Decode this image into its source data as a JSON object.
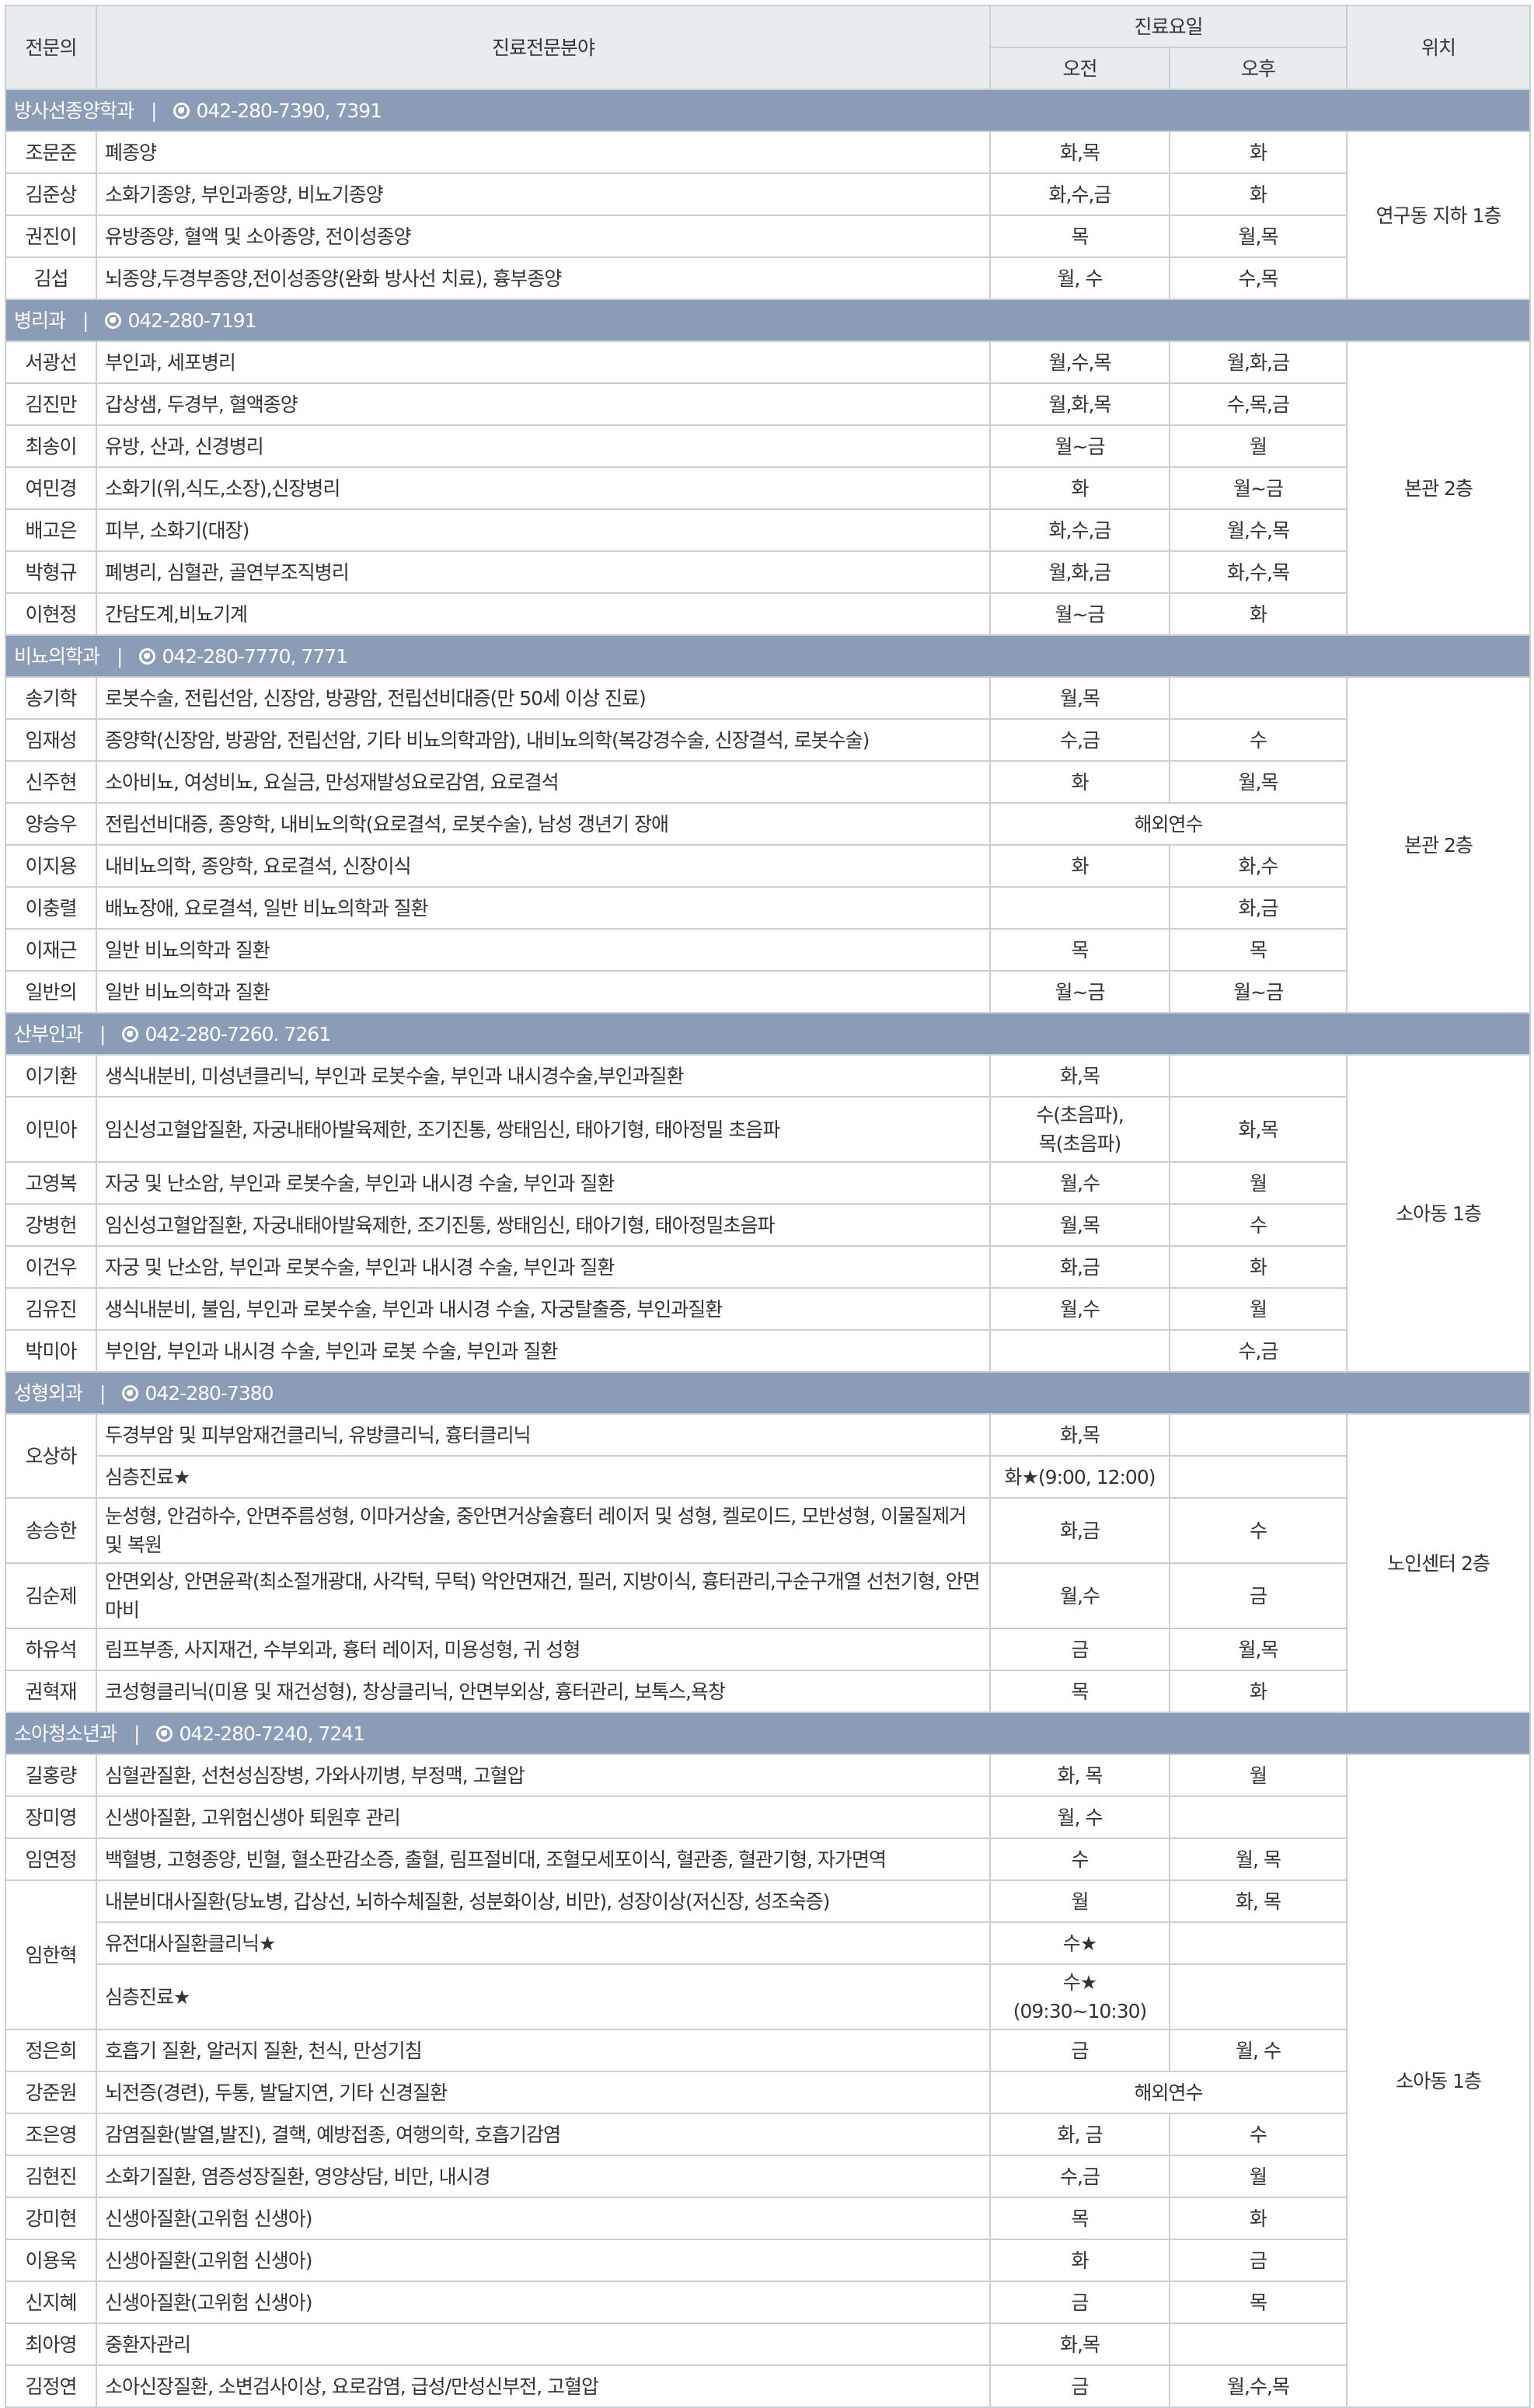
{
  "header": {
    "doctor": "전문의",
    "specialty": "진료전문분야",
    "schedule": "진료요일",
    "am": "오전",
    "pm": "오후",
    "location": "위치"
  },
  "departments": [
    {
      "name": "방사선종양학과",
      "phone": "042-280-7390, 7391",
      "location": "연구동 지하 1층",
      "doctors": [
        {
          "name": "조문준",
          "rows": [
            {
              "spec": "폐종양",
              "am": "화,목",
              "pm": "화"
            }
          ]
        },
        {
          "name": "김준상",
          "rows": [
            {
              "spec": "소화기종양, 부인과종양, 비뇨기종양",
              "am": "화,수,금",
              "pm": "화"
            }
          ]
        },
        {
          "name": "권진이",
          "rows": [
            {
              "spec": "유방종양, 혈액 및 소아종양, 전이성종양",
              "am": "목",
              "pm": "월,목"
            }
          ]
        },
        {
          "name": "김섭",
          "rows": [
            {
              "spec": "뇌종양,두경부종양,전이성종양(완화 방사선 치료), 흉부종양",
              "am": "월, 수",
              "pm": "수,목"
            }
          ]
        }
      ]
    },
    {
      "name": "병리과",
      "phone": "042-280-7191",
      "location": "본관 2층",
      "doctors": [
        {
          "name": "서광선",
          "rows": [
            {
              "spec": "부인과, 세포병리",
              "am": "월,수,목",
              "pm": "월,화,금"
            }
          ]
        },
        {
          "name": "김진만",
          "rows": [
            {
              "spec": "갑상샘, 두경부, 혈액종양",
              "am": "월,화,목",
              "pm": "수,목,금"
            }
          ]
        },
        {
          "name": "최송이",
          "rows": [
            {
              "spec": "유방, 산과, 신경병리",
              "am": "월~금",
              "pm": "월"
            }
          ]
        },
        {
          "name": "여민경",
          "rows": [
            {
              "spec": "소화기(위,식도,소장),신장병리",
              "am": "화",
              "pm": "월~금"
            }
          ]
        },
        {
          "name": "배고은",
          "rows": [
            {
              "spec": "피부, 소화기(대장)",
              "am": "화,수,금",
              "pm": "월,수,목"
            }
          ]
        },
        {
          "name": "박형규",
          "rows": [
            {
              "spec": "폐병리, 심혈관, 골연부조직병리",
              "am": "월,화,금",
              "pm": "화,수,목"
            }
          ]
        },
        {
          "name": "이현정",
          "rows": [
            {
              "spec": "간담도계,비뇨기계",
              "am": "월~금",
              "pm": "화"
            }
          ]
        }
      ]
    },
    {
      "name": "비뇨의학과",
      "phone": "042-280-7770, 7771",
      "location": "본관 2층",
      "doctors": [
        {
          "name": "송기학",
          "rows": [
            {
              "spec": "로봇수술, 전립선암, 신장암, 방광암, 전립선비대증(만 50세 이상 진료)",
              "am": "월,목",
              "pm": ""
            }
          ]
        },
        {
          "name": "임재성",
          "rows": [
            {
              "spec": "종양학(신장암, 방광암, 전립선암, 기타 비뇨의학과암), 내비뇨의학(복강경수술, 신장결석, 로봇수술)",
              "am": "수,금",
              "pm": "수"
            }
          ]
        },
        {
          "name": "신주현",
          "rows": [
            {
              "spec": "소아비뇨, 여성비뇨, 요실금, 만성재발성요로감염, 요로결석",
              "am": "화",
              "pm": "월,목"
            }
          ]
        },
        {
          "name": "양승우",
          "rows": [
            {
              "spec": "전립선비대증, 종양학, 내비뇨의학(요로결석, 로봇수술), 남성 갱년기 장애",
              "merged": "해외연수"
            }
          ]
        },
        {
          "name": "이지용",
          "rows": [
            {
              "spec": "내비뇨의학, 종양학, 요로결석, 신장이식",
              "am": "화",
              "pm": "화,수"
            }
          ]
        },
        {
          "name": "이충렬",
          "rows": [
            {
              "spec": "배뇨장애, 요로결석, 일반 비뇨의학과 질환",
              "am": "",
              "pm": "화,금"
            }
          ]
        },
        {
          "name": "이재근",
          "rows": [
            {
              "spec": "일반 비뇨의학과 질환",
              "am": "목",
              "pm": "목"
            }
          ]
        },
        {
          "name": "일반의",
          "rows": [
            {
              "spec": "일반 비뇨의학과 질환",
              "am": "월~금",
              "pm": "월~금"
            }
          ]
        }
      ]
    },
    {
      "name": "산부인과",
      "phone": "042-280-7260. 7261",
      "location": "소아동 1층",
      "doctors": [
        {
          "name": "이기환",
          "rows": [
            {
              "spec": "생식내분비, 미성년클리닉, 부인과 로봇수술, 부인과 내시경수술,부인과질환",
              "am": "화,목",
              "pm": ""
            }
          ]
        },
        {
          "name": "이민아",
          "rows": [
            {
              "spec": "임신성고혈압질환, 자궁내태아발육제한, 조기진통, 쌍태임신, 태아기형, 태아정밀 초음파",
              "am": "수(초음파),\n목(초음파)",
              "pm": "화,목"
            }
          ]
        },
        {
          "name": "고영복",
          "rows": [
            {
              "spec": "자궁 및 난소암, 부인과 로봇수술, 부인과 내시경 수술, 부인과 질환",
              "am": "월,수",
              "pm": "월"
            }
          ]
        },
        {
          "name": "강병헌",
          "rows": [
            {
              "spec": "임신성고혈압질환, 자궁내태아발육제한, 조기진통, 쌍태임신, 태아기형, 태아정밀초음파",
              "am": "월,목",
              "pm": "수"
            }
          ]
        },
        {
          "name": "이건우",
          "rows": [
            {
              "spec": "자궁 및 난소암, 부인과 로봇수술, 부인과 내시경 수술, 부인과 질환",
              "am": "화,금",
              "pm": "화"
            }
          ]
        },
        {
          "name": "김유진",
          "rows": [
            {
              "spec": "생식내분비, 불임, 부인과 로봇수술, 부인과 내시경 수술, 자궁탈출증, 부인과질환",
              "am": "월,수",
              "pm": "월"
            }
          ]
        },
        {
          "name": "박미아",
          "rows": [
            {
              "spec": "부인암, 부인과 내시경 수술, 부인과 로봇 수술, 부인과 질환",
              "am": "",
              "pm": "수,금"
            }
          ]
        }
      ]
    },
    {
      "name": "성형외과",
      "phone": "042-280-7380",
      "location": "노인센터 2층",
      "doctors": [
        {
          "name": "오상하",
          "rows": [
            {
              "spec": "두경부암 및 피부암재건클리닉, 유방클리닉, 흉터클리닉",
              "am": "화,목",
              "pm": ""
            },
            {
              "spec": "심층진료★",
              "am": "화★(9:00, 12:00)",
              "pm": ""
            }
          ]
        },
        {
          "name": "송승한",
          "rows": [
            {
              "spec": "눈성형, 안검하수, 안면주름성형, 이마거상술, 중안면거상술흉터 레이저 및 성형, 켈로이드, 모반성형, 이물질제거 및 복원",
              "am": "화,금",
              "pm": "수"
            }
          ]
        },
        {
          "name": "김순제",
          "rows": [
            {
              "spec": "안면외상, 안면윤곽(최소절개광대, 사각턱, 무턱) 악안면재건, 필러, 지방이식, 흉터관리,구순구개열 선천기형, 안면마비",
              "am": "월,수",
              "pm": "금"
            }
          ]
        },
        {
          "name": "하유석",
          "rows": [
            {
              "spec": "림프부종, 사지재건, 수부외과, 흉터 레이저, 미용성형, 귀 성형",
              "am": "금",
              "pm": "월,목"
            }
          ]
        },
        {
          "name": "권혁재",
          "rows": [
            {
              "spec": "코성형클리닉(미용 및 재건성형), 창상클리닉, 안면부외상, 흉터관리, 보톡스,욕창",
              "am": "목",
              "pm": "화"
            }
          ]
        }
      ]
    },
    {
      "name": "소아청소년과",
      "phone": "042-280-7240, 7241",
      "location": "소아동 1층",
      "doctors": [
        {
          "name": "길홍량",
          "rows": [
            {
              "spec": "심혈관질환, 선천성심장병, 가와사끼병, 부정맥, 고혈압",
              "am": "화, 목",
              "pm": "월"
            }
          ]
        },
        {
          "name": "장미영",
          "rows": [
            {
              "spec": "신생아질환, 고위험신생아 퇴원후 관리",
              "am": "월, 수",
              "pm": ""
            }
          ]
        },
        {
          "name": "임연정",
          "rows": [
            {
              "spec": "백혈병, 고형종양, 빈혈, 혈소판감소증, 출혈, 림프절비대, 조혈모세포이식, 혈관종, 혈관기형, 자가면역",
              "am": "수",
              "pm": "월, 목"
            }
          ]
        },
        {
          "name": "임한혁",
          "rows": [
            {
              "spec": "내분비대사질환(당뇨병, 갑상선, 뇌하수체질환, 성분화이상, 비만), 성장이상(저신장, 성조숙증)",
              "am": "월",
              "pm": "화, 목"
            },
            {
              "spec": "유전대사질환클리닉★",
              "am": "수★",
              "pm": ""
            },
            {
              "spec": "심층진료★",
              "am": "수★\n(09:30~10:30)",
              "pm": ""
            }
          ]
        },
        {
          "name": "정은희",
          "rows": [
            {
              "spec": "호흡기 질환, 알러지 질환, 천식, 만성기침",
              "am": "금",
              "pm": "월, 수"
            }
          ]
        },
        {
          "name": "강준원",
          "rows": [
            {
              "spec": "뇌전증(경련), 두통, 발달지연, 기타 신경질환",
              "merged": "해외연수"
            }
          ]
        },
        {
          "name": "조은영",
          "rows": [
            {
              "spec": "감염질환(발열,발진), 결핵, 예방접종, 여행의학, 호흡기감염",
              "am": "화, 금",
              "pm": "수"
            }
          ]
        },
        {
          "name": "김현진",
          "rows": [
            {
              "spec": "소화기질환, 염증성장질환, 영양상담, 비만, 내시경",
              "am": "수,금",
              "pm": "월"
            }
          ]
        },
        {
          "name": "강미현",
          "rows": [
            {
              "spec": "신생아질환(고위험 신생아)",
              "am": "목",
              "pm": "화"
            }
          ]
        },
        {
          "name": "이용욱",
          "rows": [
            {
              "spec": "신생아질환(고위험 신생아)",
              "am": "화",
              "pm": "금"
            }
          ]
        },
        {
          "name": "신지혜",
          "rows": [
            {
              "spec": "신생아질환(고위험 신생아)",
              "am": "금",
              "pm": "목"
            }
          ]
        },
        {
          "name": "최아영",
          "rows": [
            {
              "spec": "중환자관리",
              "am": "화,목",
              "pm": ""
            }
          ]
        },
        {
          "name": "김정연",
          "rows": [
            {
              "spec": "소아신장질환, 소변검사이상, 요로감염, 급성/만성신부전, 고혈압",
              "am": "금",
              "pm": "월,수,목"
            }
          ]
        }
      ]
    }
  ]
}
